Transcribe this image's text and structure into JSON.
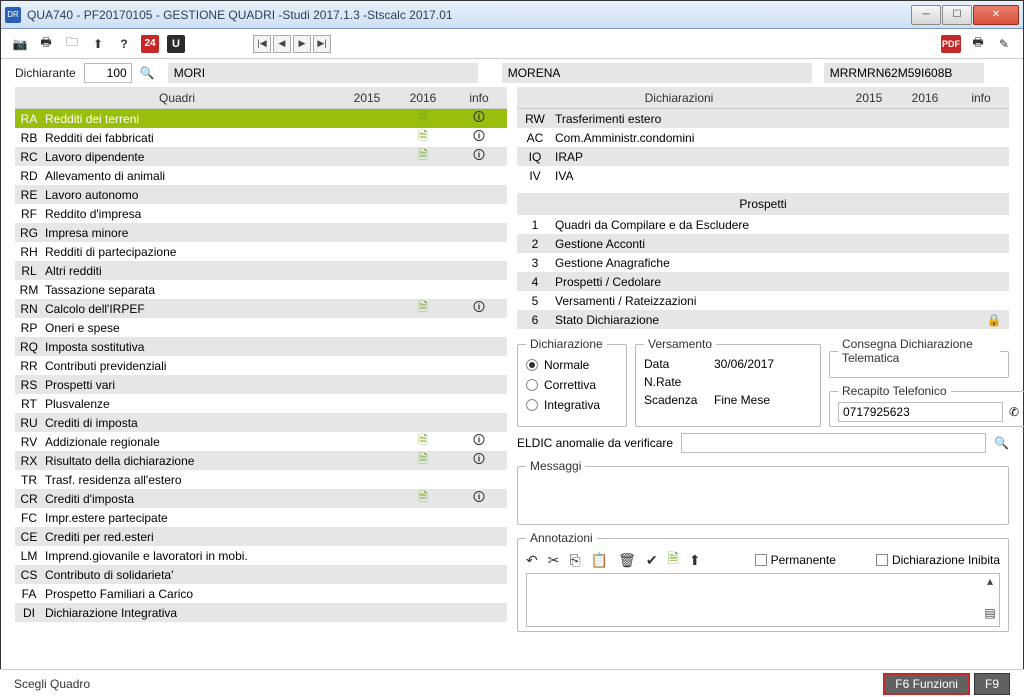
{
  "window": {
    "title": "QUA740 - PF20170105 - GESTIONE QUADRI -Studi 2017.1.3 -Stscalc 2017.01"
  },
  "header": {
    "dichiarante_label": "Dichiarante",
    "dichiarante_num": "100",
    "surname": "MORI",
    "name": "MORENA",
    "cf": "MRRMRN62M59I608B"
  },
  "grid": {
    "quadri_label": "Quadri",
    "y2015": "2015",
    "y2016": "2016",
    "info": "info",
    "dich_label": "Dichiarazioni",
    "prospetti_label": "Prospetti"
  },
  "quadri": [
    {
      "code": "RA",
      "name": "Redditi dei terreni",
      "doc2016": true,
      "info": true,
      "sel": true
    },
    {
      "code": "RB",
      "name": "Redditi dei fabbricati",
      "doc2016": true,
      "info": true
    },
    {
      "code": "RC",
      "name": "Lavoro dipendente",
      "doc2016": true,
      "info": true
    },
    {
      "code": "RD",
      "name": "Allevamento di animali"
    },
    {
      "code": "RE",
      "name": "Lavoro autonomo"
    },
    {
      "code": "RF",
      "name": "Reddito d'impresa"
    },
    {
      "code": "RG",
      "name": "Impresa minore"
    },
    {
      "code": "RH",
      "name": "Redditi di partecipazione"
    },
    {
      "code": "RL",
      "name": "Altri redditi"
    },
    {
      "code": "RM",
      "name": "Tassazione separata"
    },
    {
      "code": "RN",
      "name": "Calcolo dell'IRPEF",
      "doc2016": true,
      "info": true
    },
    {
      "code": "RP",
      "name": "Oneri e spese"
    },
    {
      "code": "RQ",
      "name": "Imposta sostitutiva"
    },
    {
      "code": "RR",
      "name": "Contributi previdenziali"
    },
    {
      "code": "RS",
      "name": "Prospetti vari"
    },
    {
      "code": "RT",
      "name": "Plusvalenze"
    },
    {
      "code": "RU",
      "name": "Crediti di imposta"
    },
    {
      "code": "RV",
      "name": "Addizionale regionale",
      "doc2016": true,
      "info": true
    },
    {
      "code": "RX",
      "name": "Risultato della dichiarazione",
      "doc2016": true,
      "info": true
    },
    {
      "code": "TR",
      "name": "Trasf. residenza all'estero"
    },
    {
      "code": "CR",
      "name": "Crediti d'imposta",
      "doc2016": true,
      "info": true
    },
    {
      "code": "FC",
      "name": "Impr.estere partecipate"
    },
    {
      "code": "CE",
      "name": "Crediti per red.esteri"
    },
    {
      "code": "LM",
      "name": "Imprend.giovanile e lavoratori in mobi."
    },
    {
      "code": "CS",
      "name": "Contributo di solidarieta'"
    },
    {
      "code": "FA",
      "name": "Prospetto Familiari a Carico"
    },
    {
      "code": "DI",
      "name": "Dichiarazione Integrativa"
    }
  ],
  "dichiarazioni": [
    {
      "code": "RW",
      "name": "Trasferimenti estero"
    },
    {
      "code": "AC",
      "name": "Com.Amministr.condomini"
    },
    {
      "code": "IQ",
      "name": "IRAP"
    },
    {
      "code": "IV",
      "name": "IVA"
    }
  ],
  "prospetti": [
    {
      "n": "1",
      "name": "Quadri da Compilare e da Escludere"
    },
    {
      "n": "2",
      "name": "Gestione Acconti"
    },
    {
      "n": "3",
      "name": "Gestione Anagrafiche"
    },
    {
      "n": "4",
      "name": "Prospetti / Cedolare"
    },
    {
      "n": "5",
      "name": "Versamenti / Rateizzazioni"
    },
    {
      "n": "6",
      "name": "Stato Dichiarazione",
      "lock": true
    }
  ],
  "dich_group": {
    "legend": "Dichiarazione",
    "normale": "Normale",
    "correttiva": "Correttiva",
    "integrativa": "Integrativa"
  },
  "vers_group": {
    "legend": "Versamento",
    "data_k": "Data",
    "data_v": "30/06/2017",
    "nrate_k": "N.Rate",
    "nrate_v": "",
    "scad_k": "Scadenza",
    "scad_v": "Fine Mese"
  },
  "consegna": {
    "legend": "Consegna Dichiarazione Telematica"
  },
  "recapito": {
    "legend": "Recapito Telefonico",
    "value": "0717925623"
  },
  "eldic": {
    "label": "ELDIC anomalie da verificare"
  },
  "messaggi": {
    "legend": "Messaggi"
  },
  "annotazioni": {
    "legend": "Annotazioni",
    "permanente": "Permanente",
    "inibita": "Dichiarazione Inibita"
  },
  "status": {
    "text": "Scegli Quadro",
    "f6": "F6 Funzioni",
    "f9": "F9"
  }
}
